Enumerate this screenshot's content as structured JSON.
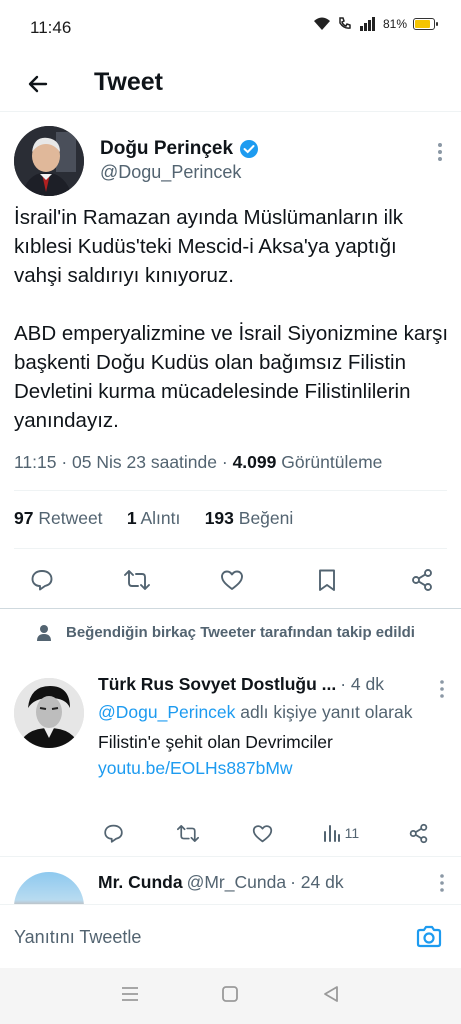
{
  "status_bar": {
    "time": "11:46",
    "battery_percent": "81%",
    "battery_level": 0.81
  },
  "header": {
    "title": "Tweet"
  },
  "tweet": {
    "author_name": "Doğu Perinçek",
    "author_handle": "@Dogu_Perincek",
    "paragraphs": [
      "İsrail'in Ramazan ayında Müslümanların ilk kıblesi Kudüs'teki Mescid-i Aksa'ya yaptığı vahşi saldırıyı kınıyoruz.",
      "ABD emperyalizmine ve İsrail Siyonizmine karşı başkenti Doğu Kudüs olan bağımsız Filistin Devletini kurma mücadelesinde Filistinlilerin yanındayız."
    ],
    "meta_time": "11:15 · 05 Nis 23 saatinde · ",
    "views_count": "4.099",
    "views_label": " Görüntüleme",
    "retweets_count": "97",
    "retweets_label": "Retweet",
    "quotes_count": "1",
    "quotes_label": "Alıntı",
    "likes_count": "193",
    "likes_label": "Beğeni"
  },
  "social_context": "Beğendiğin birkaç Tweeter tarafından takip edildi",
  "reply": {
    "name": "Türk Rus Sovyet Dostluğu ...",
    "time": "· 4 dk",
    "reply_to_handle": "@Dogu_Perincek",
    "reply_to_suffix": " adlı kişiye yanıt olarak",
    "text": "Filistin'e şehit olan Devrimciler",
    "link": "youtu.be/EOLHs887bMw",
    "views": "11"
  },
  "third": {
    "name": "Mr. Cunda",
    "handle": "@Mr_Cunda",
    "time": "· 24 dk"
  },
  "composer": {
    "placeholder": "Yanıtını Tweetle"
  },
  "colors": {
    "accent": "#1d9bf0",
    "text": "#0f1419",
    "secondary": "#536471"
  }
}
